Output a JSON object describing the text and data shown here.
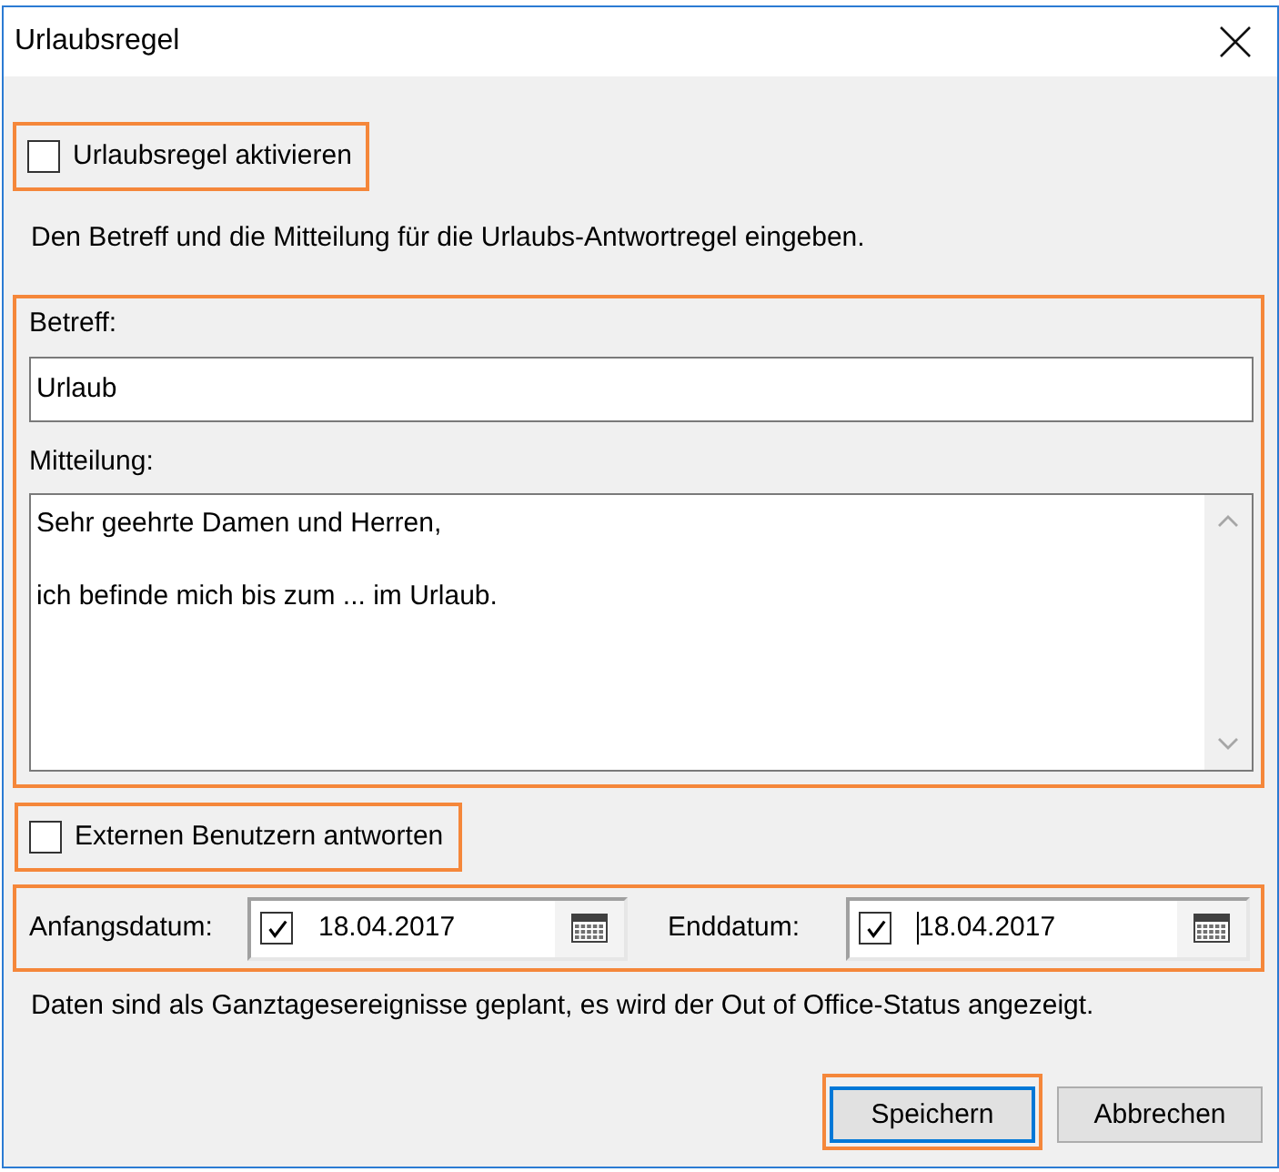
{
  "window": {
    "title": "Urlaubsregel"
  },
  "activate": {
    "label": "Urlaubsregel aktivieren",
    "checked": false,
    "highlighted": true
  },
  "intro": "Den Betreff und die Mitteilung für die Urlaubs-Antwortregel eingeben.",
  "message": {
    "highlighted": true,
    "subject_label": "Betreff:",
    "subject": "Urlaub",
    "body_label": "Mitteilung:",
    "body": [
      "Sehr geehrte Damen und Herren,",
      "ich befinde mich bis zum ... im Urlaub."
    ]
  },
  "external": {
    "label": "Externen Benutzern antworten",
    "checked": false,
    "highlighted": true
  },
  "dates": {
    "highlighted": true,
    "items": [
      {
        "label": "Anfangsdatum:",
        "checked": true,
        "value": "18.04.2017",
        "focused": false
      },
      {
        "label": "Enddatum:",
        "checked": true,
        "value": "18.04.2017",
        "focused": true
      }
    ]
  },
  "note": "Daten sind als Ganztagesereignisse geplant, es wird der Out of Office-Status angezeigt.",
  "buttons": [
    {
      "label": "Speichern",
      "default": true,
      "highlighted": true
    },
    {
      "label": "Abbrechen",
      "default": false,
      "highlighted": false
    }
  ]
}
